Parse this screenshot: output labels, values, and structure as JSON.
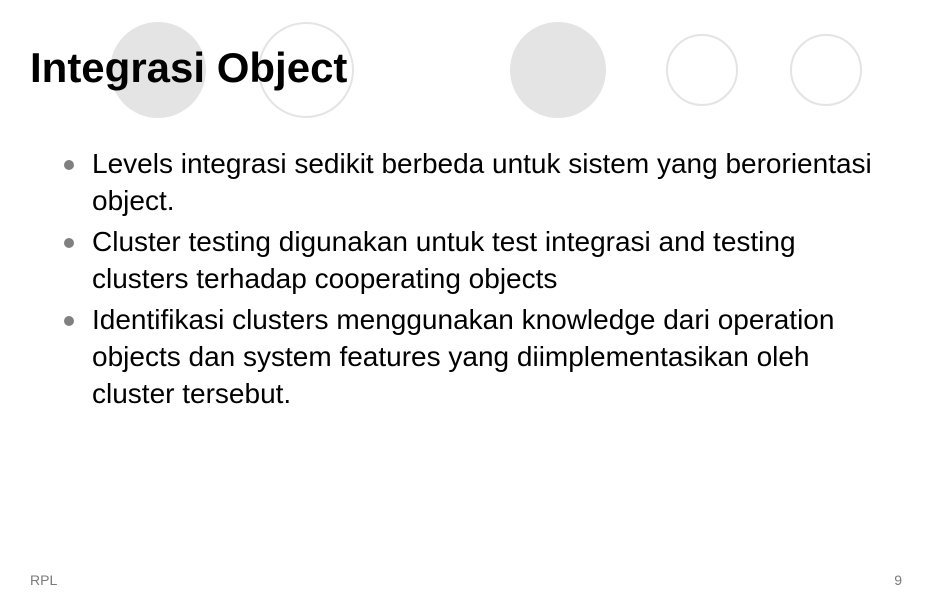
{
  "slide": {
    "title": "Integrasi Object",
    "bullets": [
      "Levels integrasi sedikit berbeda untuk sistem yang berorientasi object.",
      "Cluster testing digunakan untuk test integrasi and testing clusters terhadap cooperating objects",
      "Identifikasi clusters menggunakan knowledge dari operation objects dan system features yang diimplementasikan oleh cluster tersebut."
    ],
    "footer_left": "RPL",
    "page_number": "9"
  }
}
